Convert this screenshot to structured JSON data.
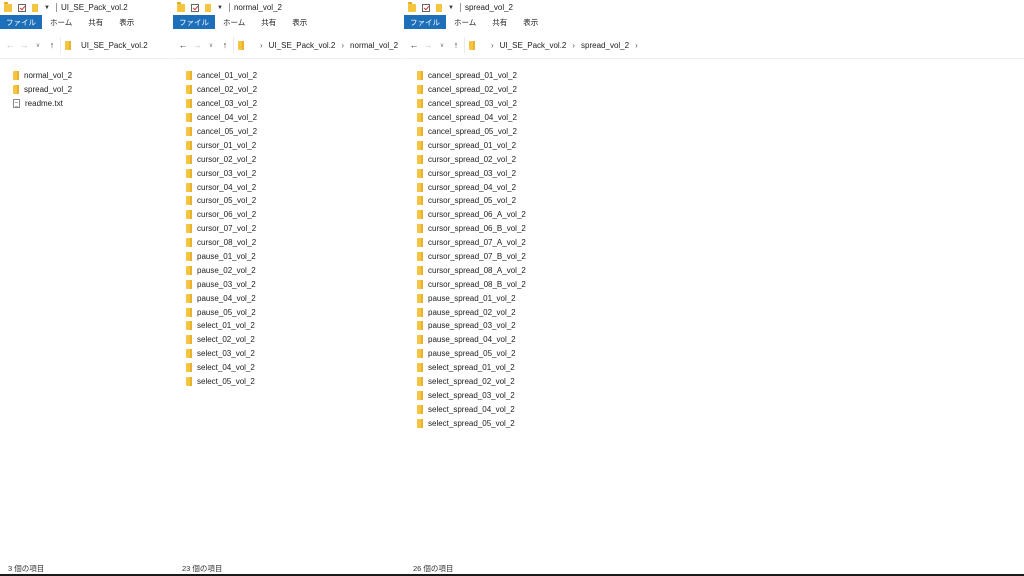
{
  "windows": [
    {
      "title": "UI_SE_Pack_vol.2",
      "ribbon_tabs": [
        "ファイル",
        "ホーム",
        "共有",
        "表示"
      ],
      "breadcrumb": [
        "UI_SE_Pack_vol.2"
      ],
      "files": [
        {
          "name": "normal_vol_2",
          "type": "folder"
        },
        {
          "name": "spread_vol_2",
          "type": "folder"
        },
        {
          "name": "readme.txt",
          "type": "text"
        }
      ],
      "status": "3 個の項目"
    },
    {
      "title": "normal_vol_2",
      "ribbon_tabs": [
        "ファイル",
        "ホーム",
        "共有",
        "表示"
      ],
      "breadcrumb": [
        "UI_SE_Pack_vol.2",
        "normal_vol_2"
      ],
      "files": [
        {
          "name": "cancel_01_vol_2",
          "type": "folder"
        },
        {
          "name": "cancel_02_vol_2",
          "type": "folder"
        },
        {
          "name": "cancel_03_vol_2",
          "type": "folder"
        },
        {
          "name": "cancel_04_vol_2",
          "type": "folder"
        },
        {
          "name": "cancel_05_vol_2",
          "type": "folder"
        },
        {
          "name": "cursor_01_vol_2",
          "type": "folder"
        },
        {
          "name": "cursor_02_vol_2",
          "type": "folder"
        },
        {
          "name": "cursor_03_vol_2",
          "type": "folder"
        },
        {
          "name": "cursor_04_vol_2",
          "type": "folder"
        },
        {
          "name": "cursor_05_vol_2",
          "type": "folder"
        },
        {
          "name": "cursor_06_vol_2",
          "type": "folder"
        },
        {
          "name": "cursor_07_vol_2",
          "type": "folder"
        },
        {
          "name": "cursor_08_vol_2",
          "type": "folder"
        },
        {
          "name": "pause_01_vol_2",
          "type": "folder"
        },
        {
          "name": "pause_02_vol_2",
          "type": "folder"
        },
        {
          "name": "pause_03_vol_2",
          "type": "folder"
        },
        {
          "name": "pause_04_vol_2",
          "type": "folder"
        },
        {
          "name": "pause_05_vol_2",
          "type": "folder"
        },
        {
          "name": "select_01_vol_2",
          "type": "folder"
        },
        {
          "name": "select_02_vol_2",
          "type": "folder"
        },
        {
          "name": "select_03_vol_2",
          "type": "folder"
        },
        {
          "name": "select_04_vol_2",
          "type": "folder"
        },
        {
          "name": "select_05_vol_2",
          "type": "folder"
        }
      ],
      "status": "23 個の項目"
    },
    {
      "title": "spread_vol_2",
      "ribbon_tabs": [
        "ファイル",
        "ホーム",
        "共有",
        "表示"
      ],
      "breadcrumb": [
        "UI_SE_Pack_vol.2",
        "spread_vol_2"
      ],
      "files": [
        {
          "name": "cancel_spread_01_vol_2",
          "type": "folder"
        },
        {
          "name": "cancel_spread_02_vol_2",
          "type": "folder"
        },
        {
          "name": "cancel_spread_03_vol_2",
          "type": "folder"
        },
        {
          "name": "cancel_spread_04_vol_2",
          "type": "folder"
        },
        {
          "name": "cancel_spread_05_vol_2",
          "type": "folder"
        },
        {
          "name": "cursor_spread_01_vol_2",
          "type": "folder"
        },
        {
          "name": "cursor_spread_02_vol_2",
          "type": "folder"
        },
        {
          "name": "cursor_spread_03_vol_2",
          "type": "folder"
        },
        {
          "name": "cursor_spread_04_vol_2",
          "type": "folder"
        },
        {
          "name": "cursor_spread_05_vol_2",
          "type": "folder"
        },
        {
          "name": "cursor_spread_06_A_vol_2",
          "type": "folder"
        },
        {
          "name": "cursor_spread_06_B_vol_2",
          "type": "folder"
        },
        {
          "name": "cursor_spread_07_A_vol_2",
          "type": "folder"
        },
        {
          "name": "cursor_spread_07_B_vol_2",
          "type": "folder"
        },
        {
          "name": "cursor_spread_08_A_vol_2",
          "type": "folder"
        },
        {
          "name": "cursor_spread_08_B_vol_2",
          "type": "folder"
        },
        {
          "name": "pause_spread_01_vol_2",
          "type": "folder"
        },
        {
          "name": "pause_spread_02_vol_2",
          "type": "folder"
        },
        {
          "name": "pause_spread_03_vol_2",
          "type": "folder"
        },
        {
          "name": "pause_spread_04_vol_2",
          "type": "folder"
        },
        {
          "name": "pause_spread_05_vol_2",
          "type": "folder"
        },
        {
          "name": "select_spread_01_vol_2",
          "type": "folder"
        },
        {
          "name": "select_spread_02_vol_2",
          "type": "folder"
        },
        {
          "name": "select_spread_03_vol_2",
          "type": "folder"
        },
        {
          "name": "select_spread_04_vol_2",
          "type": "folder"
        },
        {
          "name": "select_spread_05_vol_2",
          "type": "folder"
        }
      ],
      "status": "26 個の項目"
    }
  ],
  "colors": {
    "file_tab": "#1e6fba",
    "folder": "#f5c542"
  },
  "icons": {
    "back": "←",
    "forward": "→",
    "up": "↑",
    "recent": "∨",
    "chevron": "›"
  }
}
